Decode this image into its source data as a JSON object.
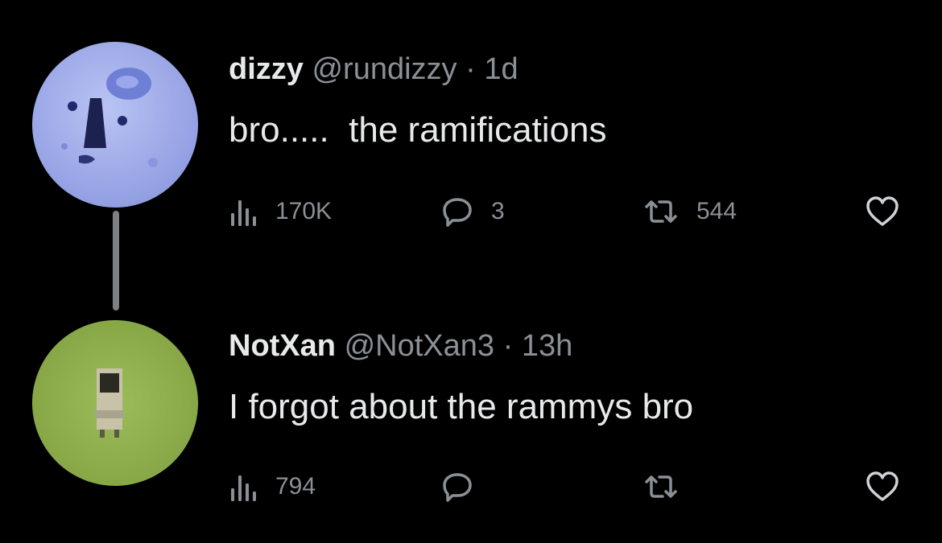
{
  "tweets": [
    {
      "display_name": "dizzy",
      "handle": "@rundizzy",
      "separator": "·",
      "time": "1d",
      "text": "bro.....  the ramifications",
      "views": "170K",
      "replies": "3",
      "retweets": "544",
      "avatar_color": "#a9b4ec"
    },
    {
      "display_name": "NotXan",
      "handle": "@NotXan3",
      "separator": "·",
      "time": "13h",
      "text": "I forgot about the rammys bro",
      "views": "794",
      "replies": "",
      "retweets": "",
      "avatar_color": "#8fb24f"
    }
  ],
  "icons": [
    "views-icon",
    "reply-icon",
    "retweet-icon",
    "like-icon"
  ]
}
